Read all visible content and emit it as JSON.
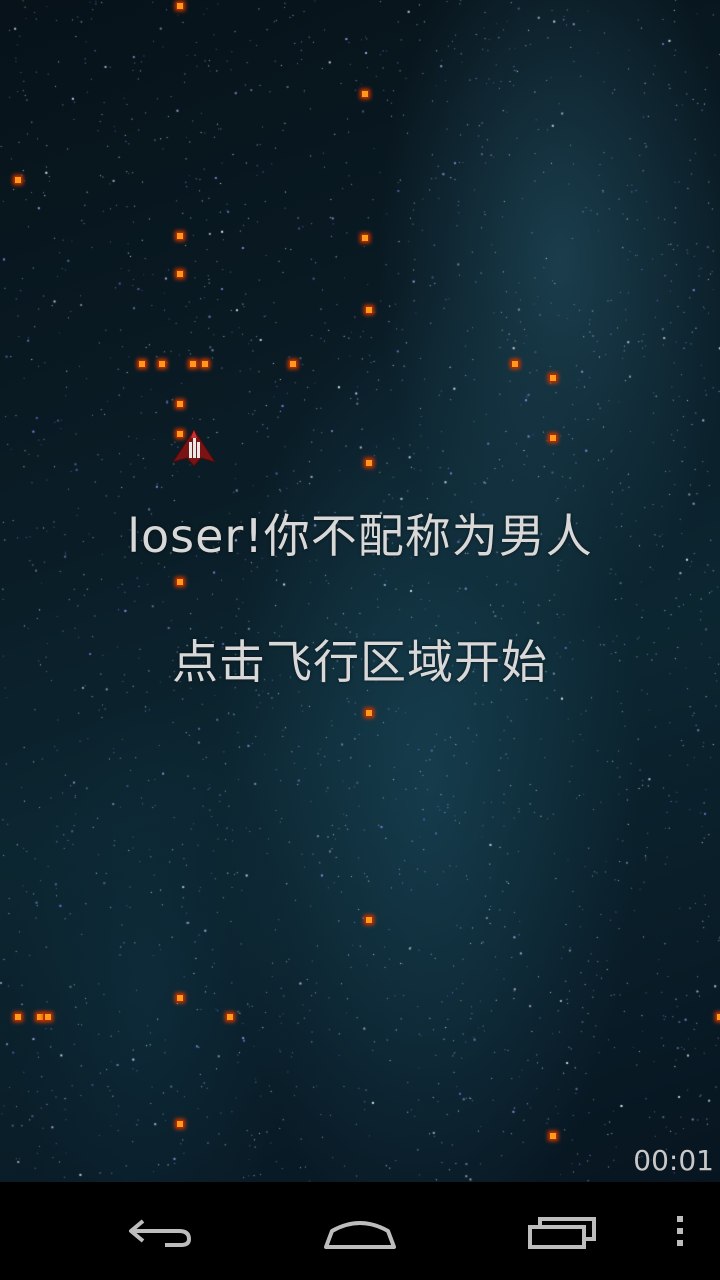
{
  "game": {
    "message_fail": "loser!你不配称为男人",
    "message_start": "点击飞行区域开始",
    "timer": "00:01"
  },
  "colors": {
    "bullet": "#ff9a1a",
    "message_text": "#d8d8d8",
    "background": "#0a1d27"
  },
  "nav_bar": {
    "back_icon": "back-arrow-icon",
    "home_icon": "home-icon",
    "recents_icon": "recent-apps-icon",
    "menu_icon": "overflow-menu-icon"
  }
}
